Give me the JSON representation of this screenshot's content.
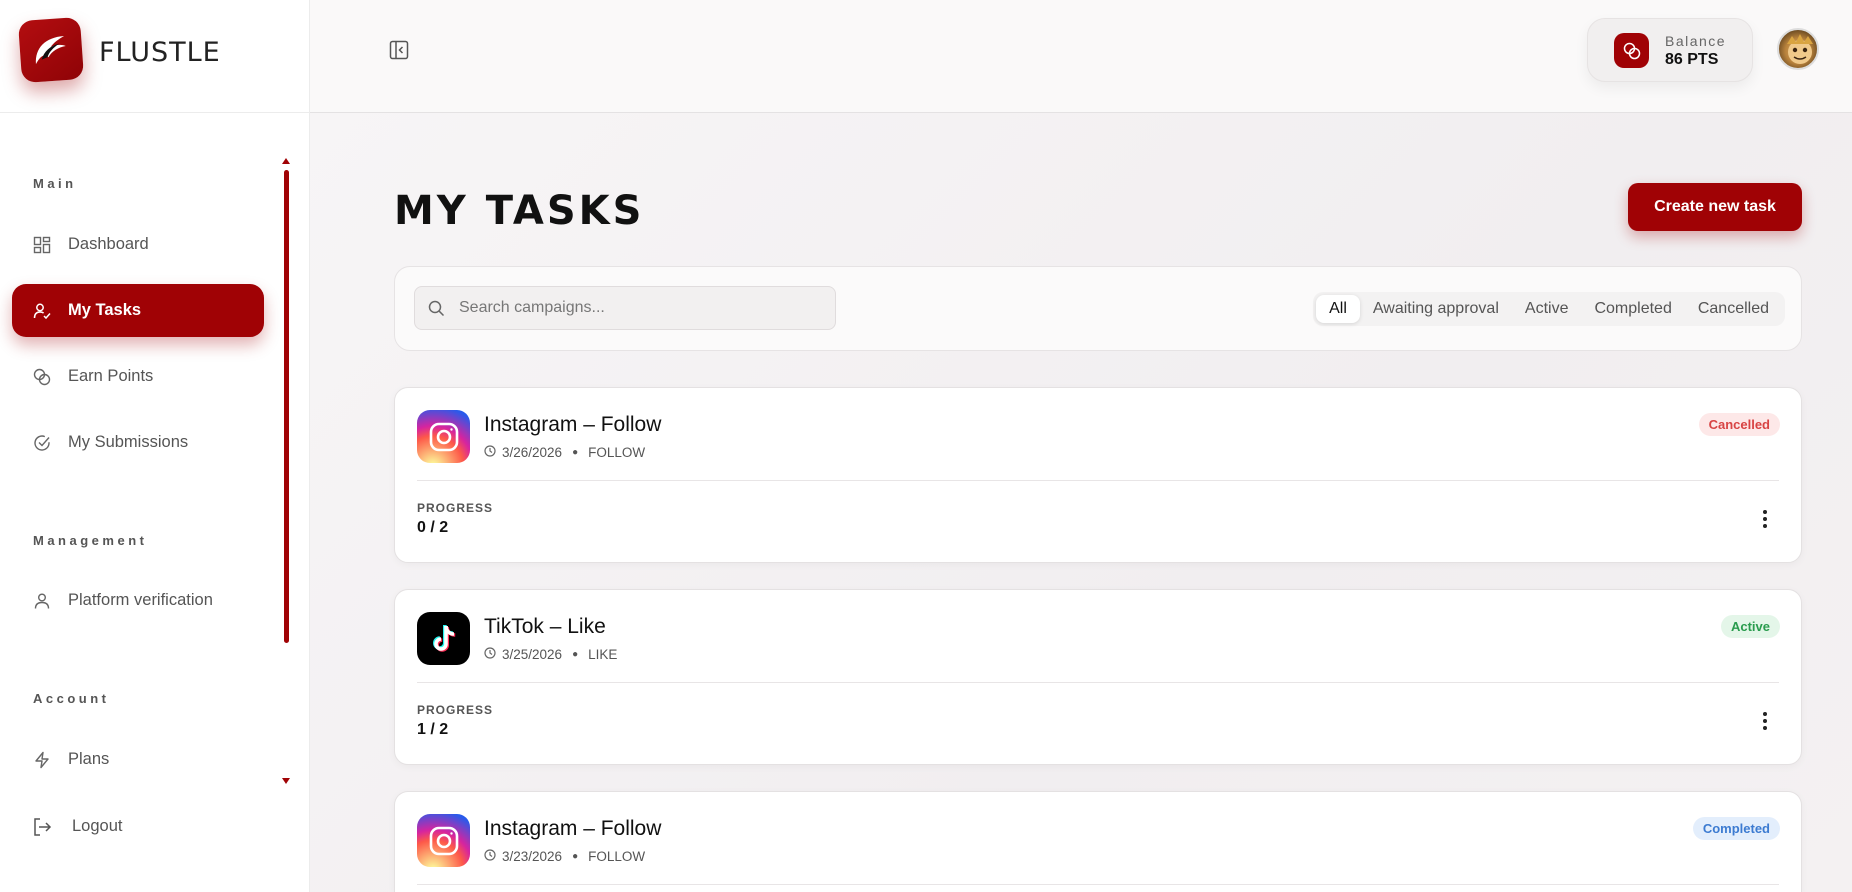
{
  "brand": {
    "name": "FLUSTLE"
  },
  "sidebar": {
    "sections": [
      {
        "label": "Main"
      },
      {
        "label": "Management"
      },
      {
        "label": "Account"
      }
    ],
    "items": [
      {
        "label": "Dashboard",
        "icon": "dashboard-icon"
      },
      {
        "label": "My Tasks",
        "icon": "user-check-icon",
        "active": true
      },
      {
        "label": "Earn Points",
        "icon": "coins-icon"
      },
      {
        "label": "My Submissions",
        "icon": "check-circle-icon"
      },
      {
        "label": "Platform verification",
        "icon": "user-icon"
      },
      {
        "label": "Plans",
        "icon": "bolt-icon"
      }
    ],
    "logout_label": "Logout"
  },
  "header": {
    "balance_label": "Balance",
    "balance_value": "86 PTS"
  },
  "main": {
    "title": "MY TASKS",
    "create_label": "Create new task",
    "search_placeholder": "Search campaigns...",
    "tabs": [
      {
        "label": "All",
        "active": true
      },
      {
        "label": "Awaiting approval"
      },
      {
        "label": "Active"
      },
      {
        "label": "Completed"
      },
      {
        "label": "Cancelled"
      }
    ],
    "progress_label": "PROGRESS",
    "tasks": [
      {
        "title": "Instagram – Follow",
        "date": "3/26/2026",
        "type": "FOLLOW",
        "status": "Cancelled",
        "progress": "0 / 2",
        "platform": "instagram"
      },
      {
        "title": "TikTok – Like",
        "date": "3/25/2026",
        "type": "LIKE",
        "status": "Active",
        "progress": "1 / 2",
        "platform": "tiktok"
      },
      {
        "title": "Instagram – Follow",
        "date": "3/23/2026",
        "type": "FOLLOW",
        "status": "Completed",
        "progress": "",
        "platform": "instagram"
      }
    ]
  },
  "colors": {
    "brand": "#a00205",
    "cancelled": "#d84444",
    "active": "#2a9c4e",
    "completed": "#3c7bd1"
  }
}
